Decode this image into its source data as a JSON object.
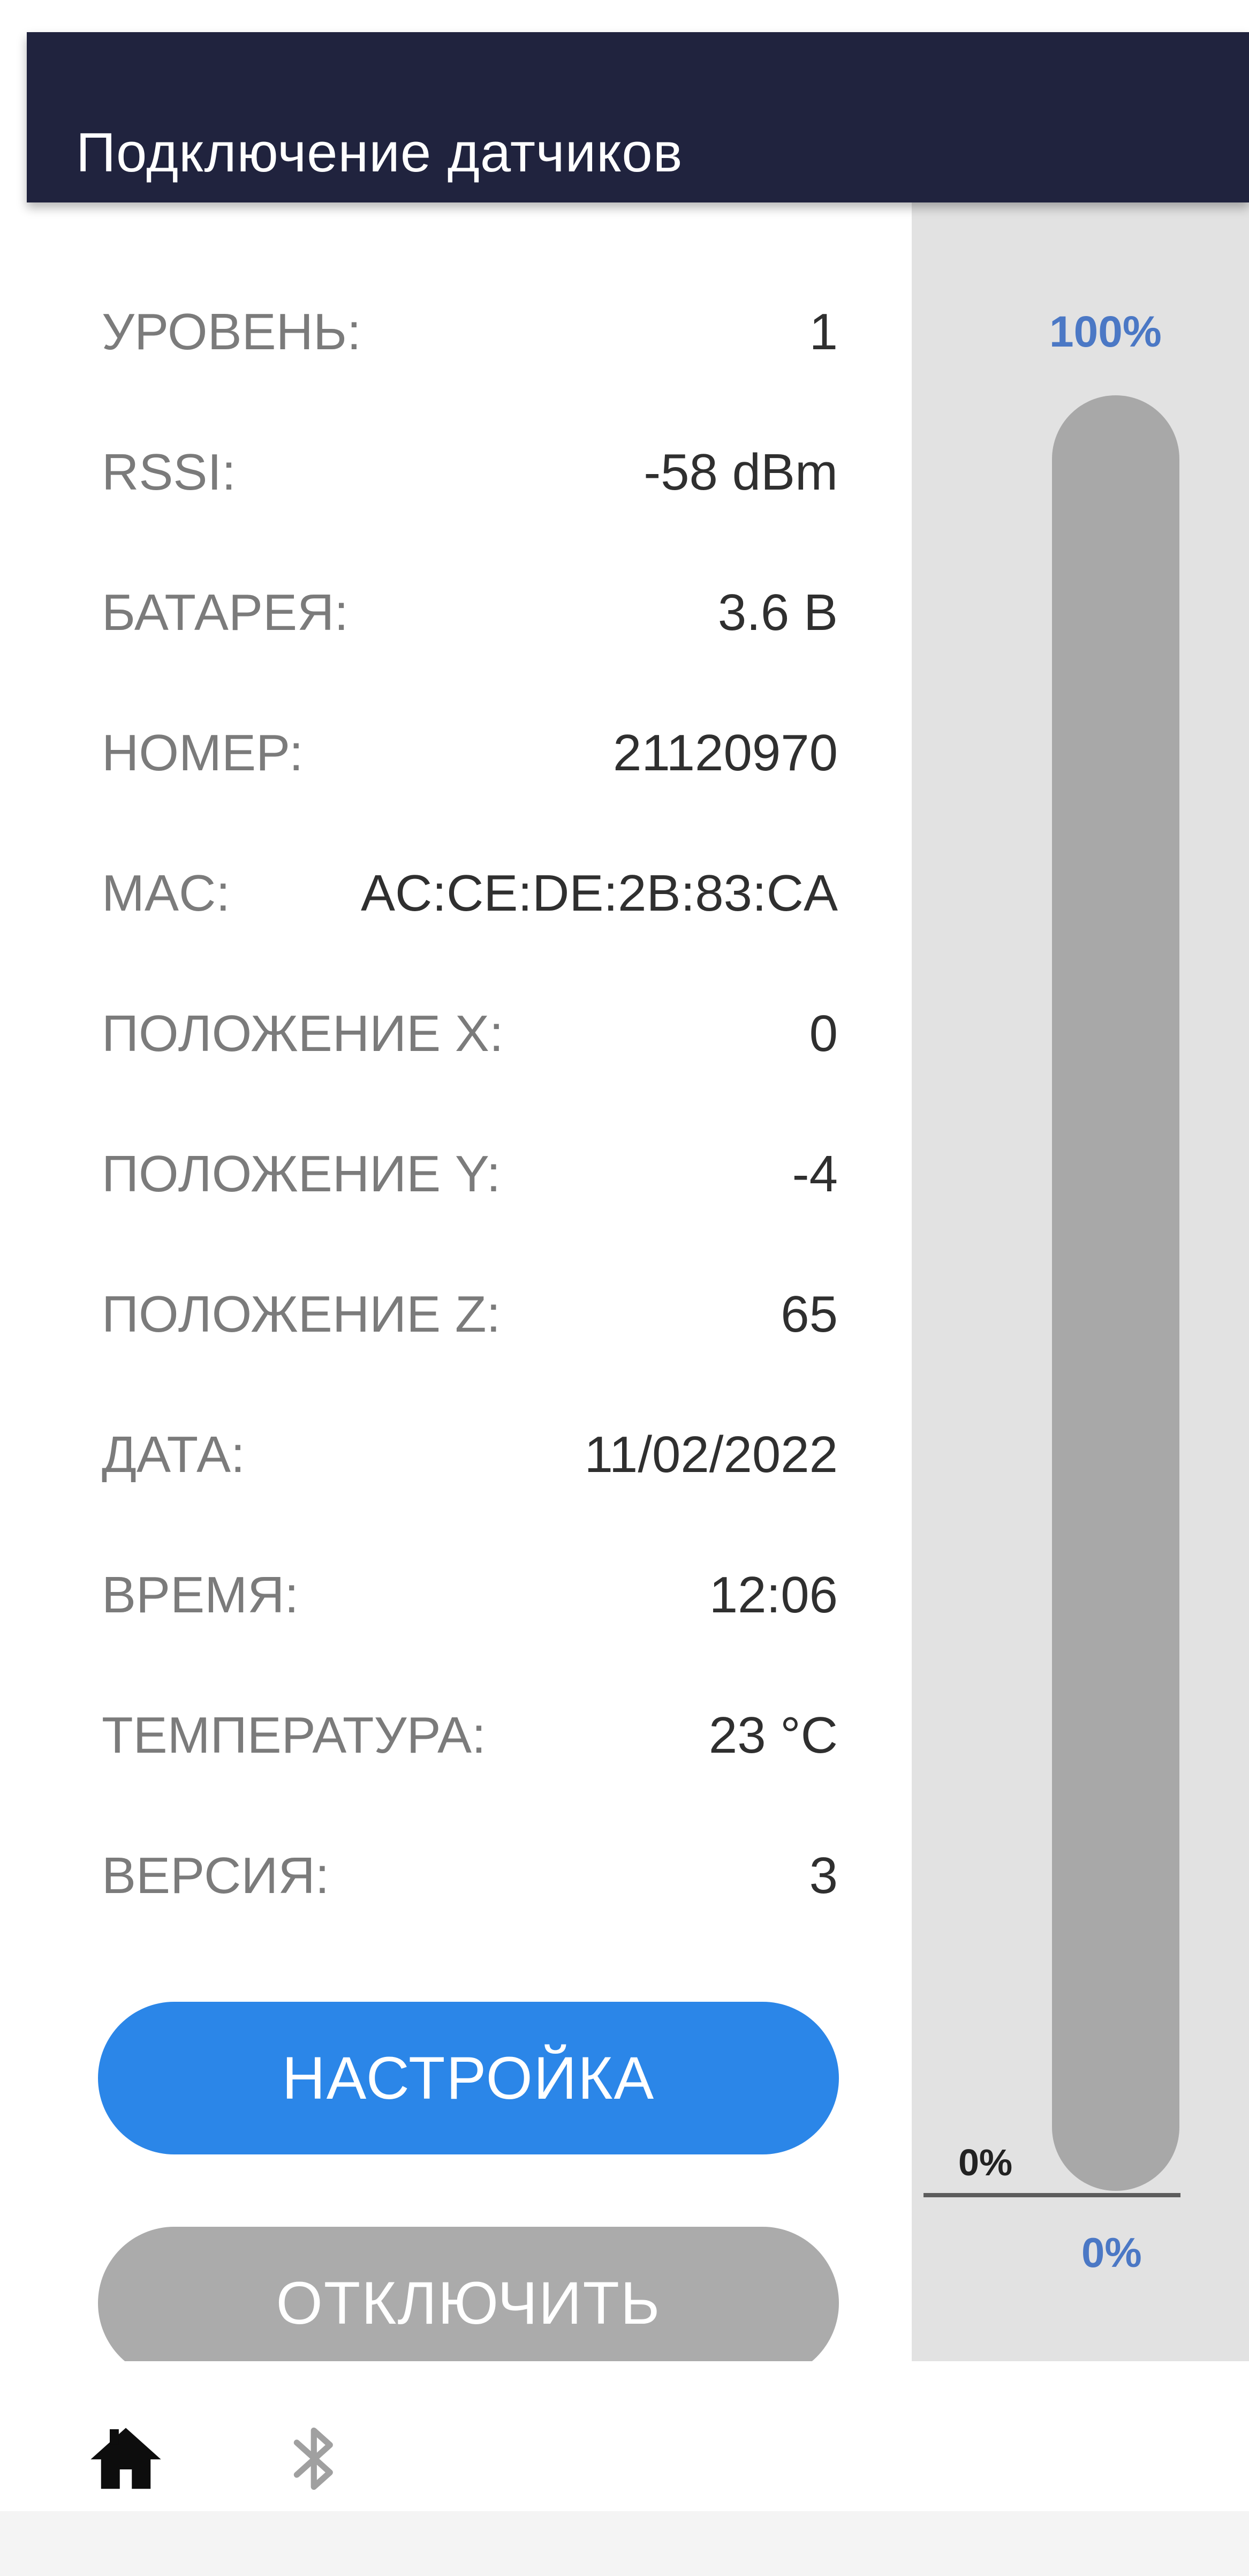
{
  "header": {
    "title": "Подключение датчиков"
  },
  "sensor_info": [
    {
      "label": "УРОВЕНЬ:",
      "value": "1"
    },
    {
      "label": "RSSI:",
      "value": "-58 dBm"
    },
    {
      "label": "БАТАРЕЯ:",
      "value": "3.6 В"
    },
    {
      "label": "НОМЕР:",
      "value": "21120970"
    },
    {
      "label": "MAC:",
      "value": "AC:CE:DE:2B:83:CA"
    },
    {
      "label": "ПОЛОЖЕНИЕ X:",
      "value": "0"
    },
    {
      "label": "ПОЛОЖЕНИЕ Y:",
      "value": "-4"
    },
    {
      "label": "ПОЛОЖЕНИЕ Z:",
      "value": "65"
    },
    {
      "label": "ДАТА:",
      "value": "11/02/2022"
    },
    {
      "label": "ВРЕМЯ:",
      "value": "12:06"
    },
    {
      "label": "ТЕМПЕРАТУРА:",
      "value": "23 °C"
    },
    {
      "label": "ВЕРСИЯ:",
      "value": "3"
    }
  ],
  "buttons": {
    "settings": "НАСТРОЙКА",
    "disconnect": "ОТКЛЮЧИТЬ"
  },
  "level_indicator": {
    "max_label": "100%",
    "zero_label": "0%",
    "value_label": "0%",
    "fill_fraction": 0
  },
  "navigation": {
    "home_icon": "home-icon",
    "bluetooth_icon": "bluetooth-icon"
  },
  "colors": {
    "header": "#20233e",
    "accent": "#2b86e8",
    "disconnect": "#ababab",
    "percent_text": "#4b78c5",
    "track": "#a8a8a8",
    "panel": "#e2e2e2"
  }
}
